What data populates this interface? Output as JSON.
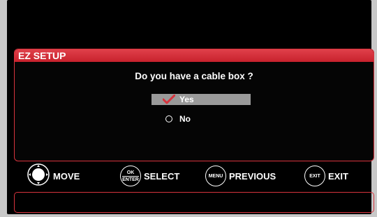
{
  "header": {
    "title": "EZ SETUP"
  },
  "question": "Do you have a cable box ?",
  "options": [
    {
      "label": "Yes",
      "selected": true,
      "icon": "checkmark-icon"
    },
    {
      "label": "No",
      "selected": false,
      "icon": "radio-icon"
    }
  ],
  "footer": {
    "move": {
      "label": "MOVE",
      "icon": "dpad-icon"
    },
    "select": {
      "label": "SELECT",
      "key_top": "OK",
      "key_bottom": "ENTER"
    },
    "previous": {
      "label": "PREVIOUS",
      "key": "MENU"
    },
    "exit": {
      "label": "EXIT",
      "key": "EXIT"
    }
  },
  "info_bar": {
    "text": ""
  },
  "colors": {
    "accent": "#d8333d",
    "selection": "#9a9a9a",
    "check": "#d8333d"
  }
}
